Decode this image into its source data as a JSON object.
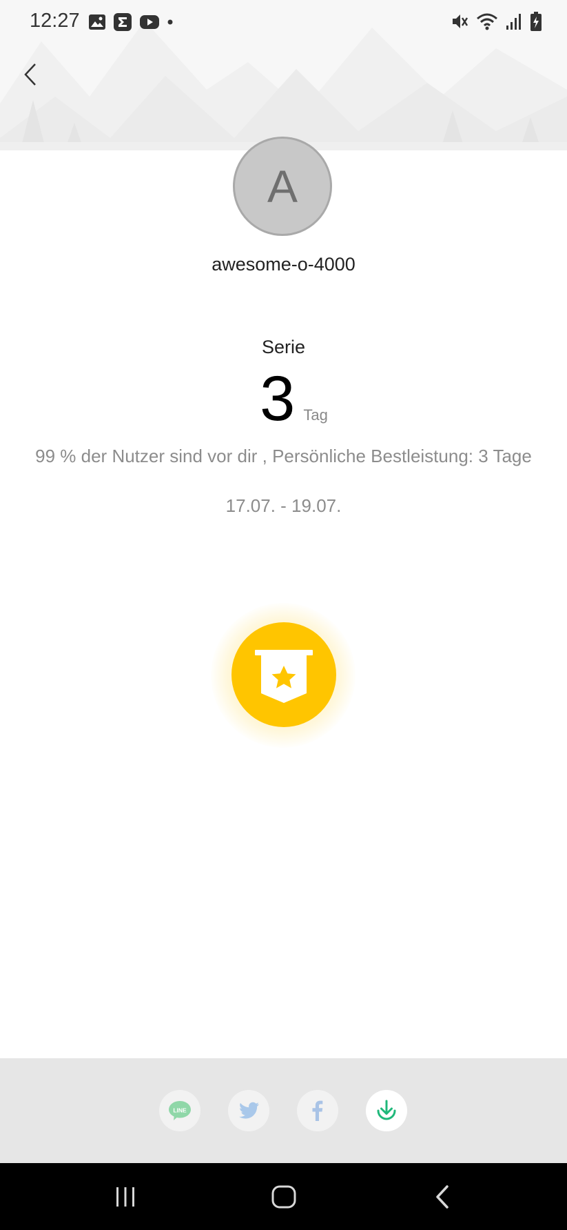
{
  "status_bar": {
    "time": "12:27",
    "left_icons": [
      "gallery-icon",
      "sigma-app-icon",
      "youtube-icon",
      "dot-icon"
    ],
    "right_icons": [
      "mute-icon",
      "wifi-icon",
      "signal-icon",
      "battery-charging-icon"
    ]
  },
  "header": {
    "back_icon": "chevron-left-icon"
  },
  "profile": {
    "avatar_letter": "A",
    "username": "awesome-o-4000"
  },
  "streak": {
    "label": "Serie",
    "value": "3",
    "unit": "Tag",
    "stats_text": "99 % der Nutzer sind vor dir , Persönliche Bestleistung: 3 Tage",
    "date_range": "17.07. - 19.07."
  },
  "badge": {
    "icon": "banner-star-icon",
    "color": "#ffc500"
  },
  "share": {
    "buttons": [
      {
        "name": "LINE",
        "icon": "line-icon",
        "color": "#8fd7a8"
      },
      {
        "name": "Twitter",
        "icon": "twitter-icon",
        "color": "#a9c8ea"
      },
      {
        "name": "Facebook",
        "icon": "facebook-icon",
        "color": "#a9c3e6"
      },
      {
        "name": "Download",
        "icon": "download-icon",
        "color": "#1fb87a"
      }
    ]
  },
  "nav_bar": {
    "buttons": [
      "recents-icon",
      "home-icon",
      "back-icon"
    ]
  }
}
